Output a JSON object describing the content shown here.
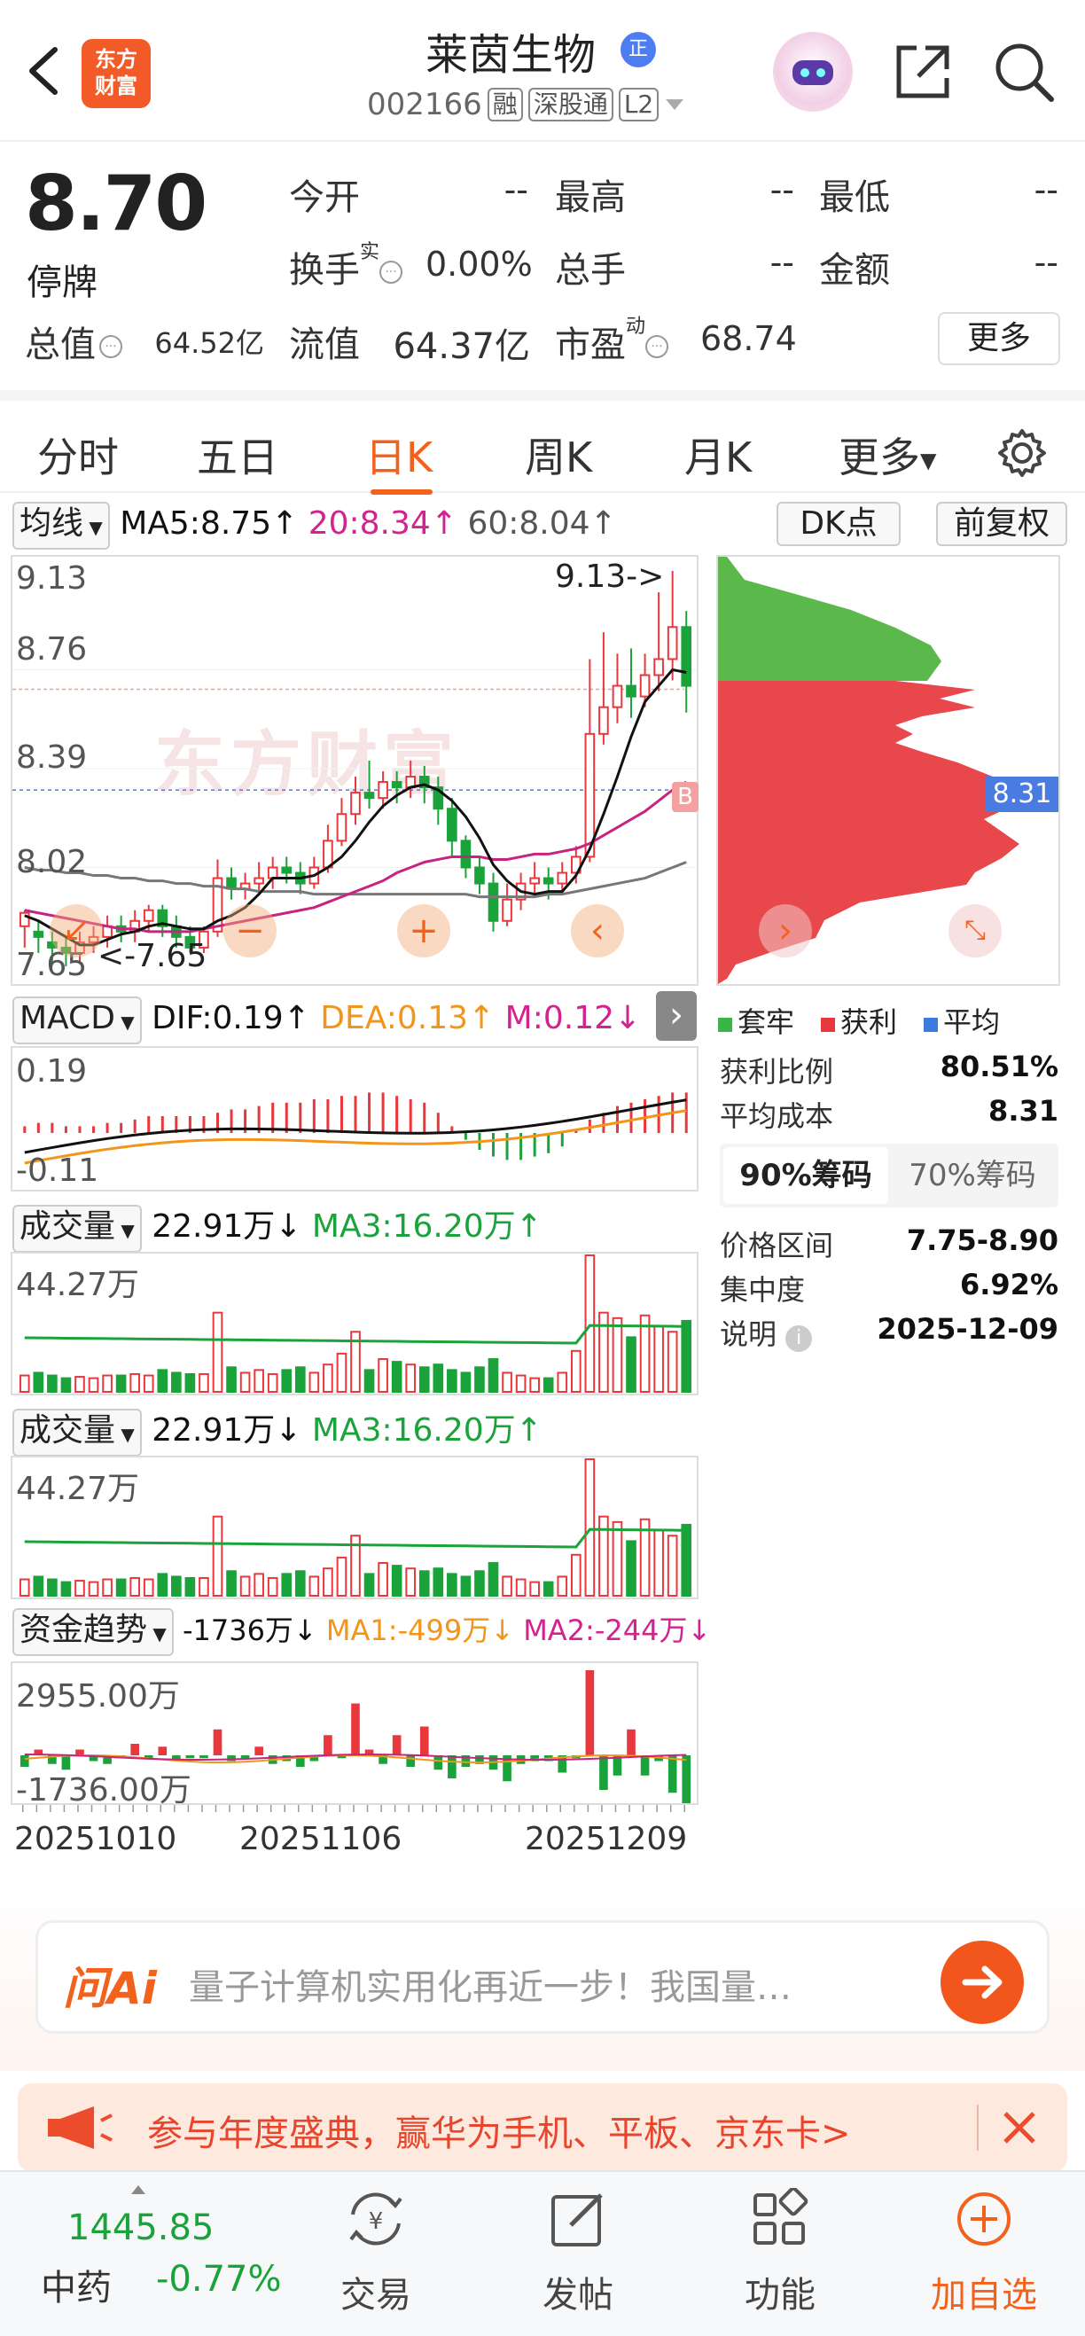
{
  "header": {
    "stock_name": "莱茵生物",
    "badge": "正",
    "stock_code": "002166",
    "tags": [
      "融",
      "深股通",
      "L2"
    ],
    "logo_lines": [
      "东方",
      "财富"
    ]
  },
  "quote": {
    "price": "8.70",
    "status": "停牌",
    "fields": {
      "open_label": "今开",
      "open_value": "--",
      "high_label": "最高",
      "high_value": "--",
      "low_label": "最低",
      "low_value": "--",
      "turnover_label": "换手",
      "turnover_sup": "实",
      "turnover_value": "0.00%",
      "volume_label": "总手",
      "volume_value": "--",
      "amount_label": "金额",
      "amount_value": "--",
      "mktcap_label": "总值",
      "mktcap_value": "64.52亿",
      "float_label": "流值",
      "float_value": "64.37亿",
      "pe_label": "市盈",
      "pe_sup": "动",
      "pe_value": "68.74"
    },
    "more_label": "更多"
  },
  "tabs": {
    "items": [
      "分时",
      "五日",
      "日K",
      "周K",
      "月K",
      "更多"
    ],
    "active": "日K"
  },
  "ma_bar": {
    "select_label": "均线",
    "ma5": "MA5:8.75↑",
    "ma20": "20:8.34↑",
    "ma60": "60:8.04↑",
    "dk_label": "DK点",
    "adjust_label": "前复权"
  },
  "kline": {
    "y_labels": [
      "9.13",
      "8.76",
      "8.39",
      "8.02",
      "7.65"
    ],
    "high_annotation": "9.13->",
    "low_annotation": "<-7.65",
    "watermark": "东方财富",
    "b_marker": "B"
  },
  "chip_chart": {
    "avg_label": "8.31",
    "legend": [
      "套牢",
      "获利",
      "平均"
    ],
    "profit_ratio_label": "获利比例",
    "profit_ratio_value": "80.51%",
    "avg_cost_label": "平均成本",
    "avg_cost_value": "8.31",
    "tab_90": "90%筹码",
    "tab_70": "70%筹码",
    "range_label": "价格区间",
    "range_value": "7.75-8.90",
    "concentration_label": "集中度",
    "concentration_value": "6.92%",
    "note_label": "说明",
    "note_date": "2025-12-09"
  },
  "macd": {
    "select_label": "MACD",
    "dif": "DIF:0.19↑",
    "dea": "DEA:0.13↑",
    "m": "M:0.12↓",
    "top_label": "0.19",
    "bottom_label": "-0.11"
  },
  "volume1": {
    "select_label": "成交量",
    "value": "22.91万↓",
    "ma3": "MA3:16.20万↑",
    "top_label": "44.27万"
  },
  "volume2": {
    "select_label": "成交量",
    "value": "22.91万↓",
    "ma3": "MA3:16.20万↑",
    "top_label": "44.27万"
  },
  "fund": {
    "select_label": "资金趋势",
    "value": "-1736万↓",
    "ma1": "MA1:-499万↓",
    "ma2": "MA2:-244万↓",
    "top_label": "2955.00万",
    "bottom_label": "-1736.00万"
  },
  "dates": [
    "20251010",
    "20251106",
    "20251209"
  ],
  "ai": {
    "logo": "问Ai",
    "placeholder": "量子计算机实用化再近一步！我国量…"
  },
  "promo": {
    "text": "参与年度盛典，赢华为手机、平板、京东卡>"
  },
  "bottom_nav": {
    "index_value": "1445.85",
    "index_name": "中药",
    "index_change": "-0.77%",
    "trade_label": "交易",
    "post_label": "发帖",
    "function_label": "功能",
    "add_label": "加自选"
  },
  "colors": {
    "up": "#e8383d",
    "down": "#1aa33a",
    "accent": "#f2621d",
    "ma5": "#111111",
    "ma20": "#c8237f",
    "ma60": "#777777",
    "dea": "#f29518"
  },
  "chart_data": {
    "type": "candlestick",
    "ylim": [
      7.65,
      9.13
    ],
    "candles": [
      [
        7.8,
        7.85,
        7.72,
        7.86
      ],
      [
        7.78,
        7.76,
        7.7,
        7.82
      ],
      [
        7.74,
        7.72,
        7.66,
        7.78
      ],
      [
        7.72,
        7.7,
        7.65,
        7.76
      ],
      [
        7.7,
        7.74,
        7.66,
        7.78
      ],
      [
        7.74,
        7.76,
        7.7,
        7.8
      ],
      [
        7.76,
        7.8,
        7.72,
        7.84
      ],
      [
        7.8,
        7.78,
        7.74,
        7.84
      ],
      [
        7.78,
        7.82,
        7.74,
        7.86
      ],
      [
        7.82,
        7.86,
        7.78,
        7.88
      ],
      [
        7.86,
        7.8,
        7.76,
        7.88
      ],
      [
        7.8,
        7.76,
        7.72,
        7.84
      ],
      [
        7.76,
        7.72,
        7.7,
        7.8
      ],
      [
        7.72,
        7.78,
        7.7,
        7.8
      ],
      [
        7.78,
        7.98,
        7.76,
        8.05
      ],
      [
        7.98,
        7.94,
        7.9,
        8.02
      ],
      [
        7.94,
        7.96,
        7.9,
        8.0
      ],
      [
        7.96,
        7.98,
        7.92,
        8.04
      ],
      [
        7.98,
        8.02,
        7.94,
        8.06
      ],
      [
        8.02,
        8.0,
        7.96,
        8.06
      ],
      [
        8.0,
        7.96,
        7.92,
        8.04
      ],
      [
        7.96,
        8.02,
        7.94,
        8.06
      ],
      [
        8.02,
        8.12,
        8.0,
        8.18
      ],
      [
        8.12,
        8.22,
        8.1,
        8.28
      ],
      [
        8.22,
        8.3,
        8.18,
        8.36
      ],
      [
        8.3,
        8.28,
        8.24,
        8.42
      ],
      [
        8.28,
        8.34,
        8.24,
        8.38
      ],
      [
        8.34,
        8.32,
        8.26,
        8.38
      ],
      [
        8.32,
        8.36,
        8.28,
        8.42
      ],
      [
        8.36,
        8.32,
        8.26,
        8.4
      ],
      [
        8.32,
        8.24,
        8.18,
        8.36
      ],
      [
        8.24,
        8.12,
        8.06,
        8.28
      ],
      [
        8.12,
        8.02,
        7.98,
        8.14
      ],
      [
        8.02,
        7.96,
        7.92,
        8.06
      ],
      [
        7.96,
        7.82,
        7.78,
        8.0
      ],
      [
        7.82,
        7.9,
        7.8,
        7.96
      ],
      [
        7.9,
        7.96,
        7.86,
        8.0
      ],
      [
        7.96,
        7.98,
        7.92,
        8.04
      ],
      [
        7.98,
        7.96,
        7.9,
        8.02
      ],
      [
        7.96,
        8.0,
        7.92,
        8.04
      ],
      [
        8.0,
        8.06,
        7.96,
        8.1
      ],
      [
        8.06,
        8.52,
        8.04,
        8.8
      ],
      [
        8.52,
        8.62,
        8.48,
        8.9
      ],
      [
        8.62,
        8.7,
        8.56,
        8.82
      ],
      [
        8.7,
        8.66,
        8.58,
        8.84
      ],
      [
        8.66,
        8.74,
        8.62,
        8.82
      ],
      [
        8.74,
        8.8,
        8.68,
        9.05
      ],
      [
        8.8,
        8.92,
        8.72,
        9.13
      ],
      [
        8.92,
        8.7,
        8.6,
        8.98
      ]
    ],
    "ma5": [
      7.84,
      7.82,
      7.79,
      7.76,
      7.73,
      7.73,
      7.75,
      7.77,
      7.78,
      7.8,
      7.81,
      7.8,
      7.79,
      7.79,
      7.82,
      7.84,
      7.87,
      7.92,
      7.98,
      7.98,
      7.98,
      7.99,
      8.02,
      8.06,
      8.12,
      8.19,
      8.25,
      8.29,
      8.32,
      8.33,
      8.31,
      8.27,
      8.21,
      8.13,
      8.03,
      7.97,
      7.93,
      7.92,
      7.93,
      7.93,
      7.99,
      8.09,
      8.22,
      8.36,
      8.51,
      8.64,
      8.7,
      8.76,
      8.75
    ],
    "ma20": [
      7.86,
      7.85,
      7.84,
      7.83,
      7.82,
      7.81,
      7.8,
      7.79,
      7.79,
      7.78,
      7.78,
      7.78,
      7.78,
      7.79,
      7.8,
      7.81,
      7.82,
      7.83,
      7.84,
      7.85,
      7.86,
      7.87,
      7.89,
      7.91,
      7.93,
      7.95,
      7.97,
      8.0,
      8.02,
      8.04,
      8.05,
      8.06,
      8.06,
      8.06,
      8.05,
      8.05,
      8.06,
      8.07,
      8.07,
      8.08,
      8.09,
      8.11,
      8.14,
      8.17,
      8.2,
      8.23,
      8.27,
      8.31,
      8.34
    ],
    "ma60": [
      8.02,
      8.01,
      8.01,
      8.0,
      8.0,
      7.99,
      7.99,
      7.98,
      7.98,
      7.97,
      7.97,
      7.96,
      7.96,
      7.95,
      7.95,
      7.94,
      7.94,
      7.93,
      7.93,
      7.93,
      7.93,
      7.92,
      7.92,
      7.92,
      7.92,
      7.92,
      7.92,
      7.92,
      7.92,
      7.92,
      7.92,
      7.92,
      7.92,
      7.91,
      7.91,
      7.91,
      7.91,
      7.91,
      7.92,
      7.92,
      7.93,
      7.94,
      7.95,
      7.96,
      7.97,
      7.98,
      8.0,
      8.02,
      8.04
    ],
    "macd_hist": [
      0.02,
      0.03,
      0.03,
      0.02,
      0.02,
      0.02,
      0.03,
      0.03,
      0.04,
      0.05,
      0.05,
      0.05,
      0.05,
      0.05,
      0.06,
      0.07,
      0.07,
      0.08,
      0.09,
      0.09,
      0.09,
      0.1,
      0.1,
      0.11,
      0.11,
      0.12,
      0.12,
      0.11,
      0.1,
      0.09,
      0.06,
      0.02,
      -0.02,
      -0.05,
      -0.07,
      -0.08,
      -0.08,
      -0.07,
      -0.06,
      -0.04,
      0.01,
      0.04,
      0.06,
      0.08,
      0.09,
      0.1,
      0.11,
      0.12,
      0.12
    ],
    "volume_pct": [
      12,
      14,
      12,
      10,
      11,
      10,
      12,
      12,
      13,
      12,
      16,
      14,
      13,
      13,
      58,
      18,
      14,
      16,
      13,
      16,
      18,
      14,
      20,
      28,
      44,
      16,
      24,
      22,
      20,
      18,
      20,
      16,
      14,
      18,
      24,
      14,
      12,
      10,
      10,
      14,
      30,
      100,
      58,
      54,
      40,
      56,
      48,
      44,
      52
    ],
    "fund_flow": [
      -400,
      200,
      -300,
      -500,
      200,
      -200,
      -300,
      -100,
      400,
      -100,
      300,
      -200,
      -100,
      -100,
      900,
      -200,
      -100,
      300,
      -300,
      -200,
      -400,
      -200,
      700,
      -100,
      1800,
      200,
      -300,
      700,
      -400,
      1000,
      -500,
      -800,
      -400,
      -300,
      -500,
      -900,
      -300,
      -200,
      -200,
      -600,
      -100,
      2955,
      -1200,
      -700,
      900,
      -700,
      -200,
      -1300,
      -1736
    ]
  }
}
